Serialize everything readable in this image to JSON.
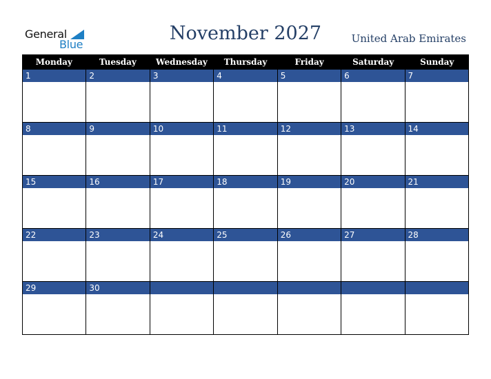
{
  "logo": {
    "general": "General",
    "blue": "Blue"
  },
  "title": "November 2027",
  "country": "United Arab Emirates",
  "days": [
    "Monday",
    "Tuesday",
    "Wednesday",
    "Thursday",
    "Friday",
    "Saturday",
    "Sunday"
  ],
  "weeks": [
    [
      "1",
      "2",
      "3",
      "4",
      "5",
      "6",
      "7"
    ],
    [
      "8",
      "9",
      "10",
      "11",
      "12",
      "13",
      "14"
    ],
    [
      "15",
      "16",
      "17",
      "18",
      "19",
      "20",
      "21"
    ],
    [
      "22",
      "23",
      "24",
      "25",
      "26",
      "27",
      "28"
    ],
    [
      "29",
      "30",
      "",
      "",
      "",
      "",
      ""
    ]
  ]
}
